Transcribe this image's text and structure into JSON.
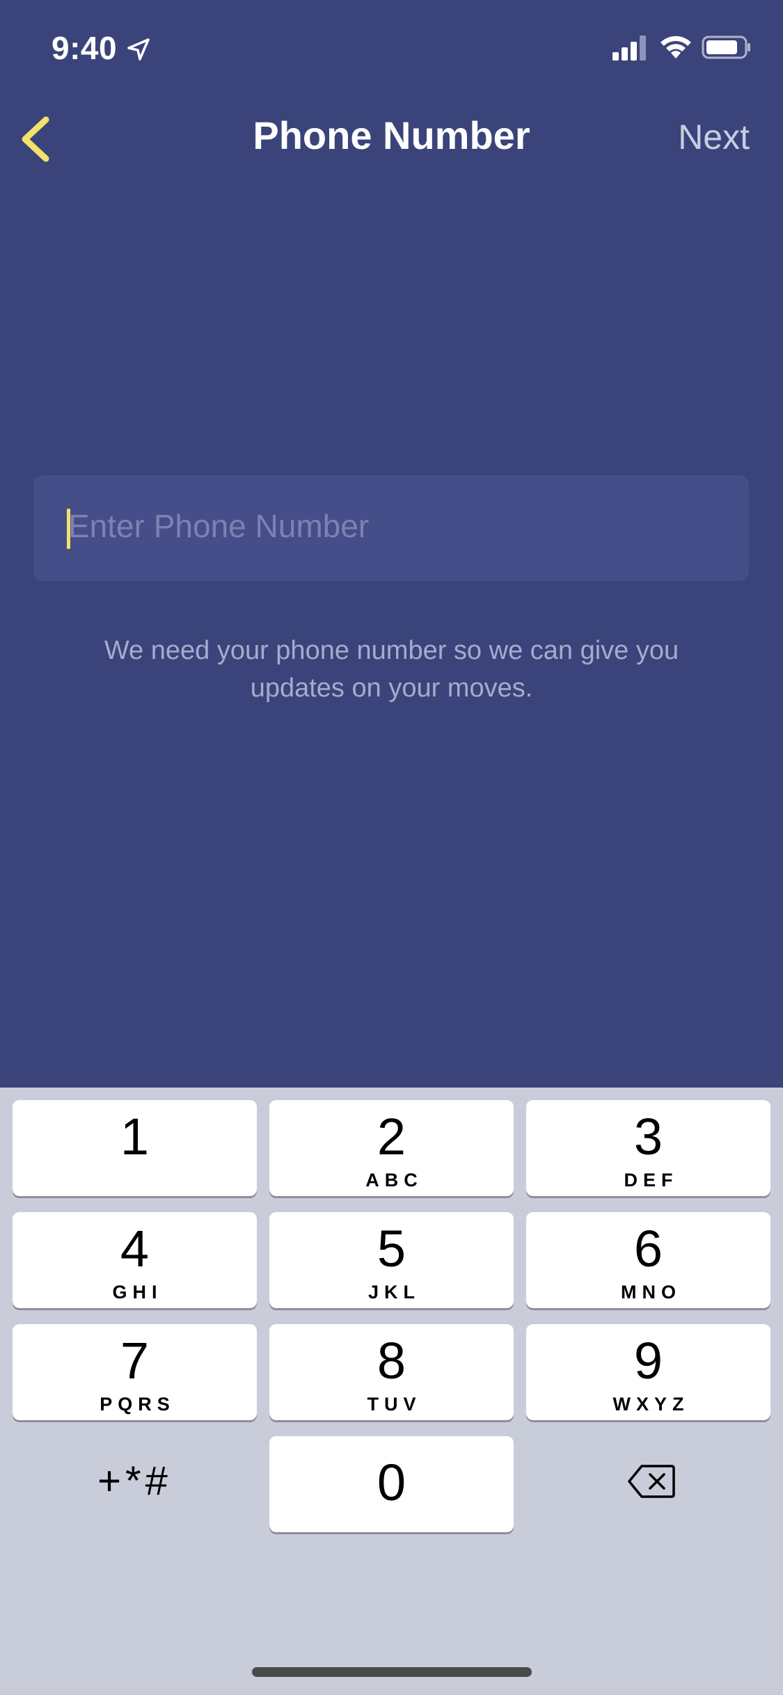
{
  "status_bar": {
    "time": "9:40",
    "location_icon": "location-arrow-icon",
    "signal_icon": "cellular-signal-icon",
    "wifi_icon": "wifi-icon",
    "battery_icon": "battery-icon"
  },
  "nav": {
    "back_icon": "chevron-left-icon",
    "title": "Phone Number",
    "next_label": "Next"
  },
  "phone_input": {
    "placeholder": "Enter Phone Number",
    "value": ""
  },
  "helper_text": "We need your phone number so we can give you updates on your moves.",
  "keypad": {
    "keys": [
      {
        "digit": "1",
        "letters": ""
      },
      {
        "digit": "2",
        "letters": "ABC"
      },
      {
        "digit": "3",
        "letters": "DEF"
      },
      {
        "digit": "4",
        "letters": "GHI"
      },
      {
        "digit": "5",
        "letters": "JKL"
      },
      {
        "digit": "6",
        "letters": "MNO"
      },
      {
        "digit": "7",
        "letters": "PQRS"
      },
      {
        "digit": "8",
        "letters": "TUV"
      },
      {
        "digit": "9",
        "letters": "WXYZ"
      },
      {
        "digit": "0",
        "letters": ""
      }
    ],
    "symbols_label": "+*#",
    "delete_icon": "backspace-icon"
  },
  "colors": {
    "background": "#3a447a",
    "accent": "#f3e26a",
    "field_background": "#454e88",
    "keyboard_background": "#c9cdda"
  }
}
